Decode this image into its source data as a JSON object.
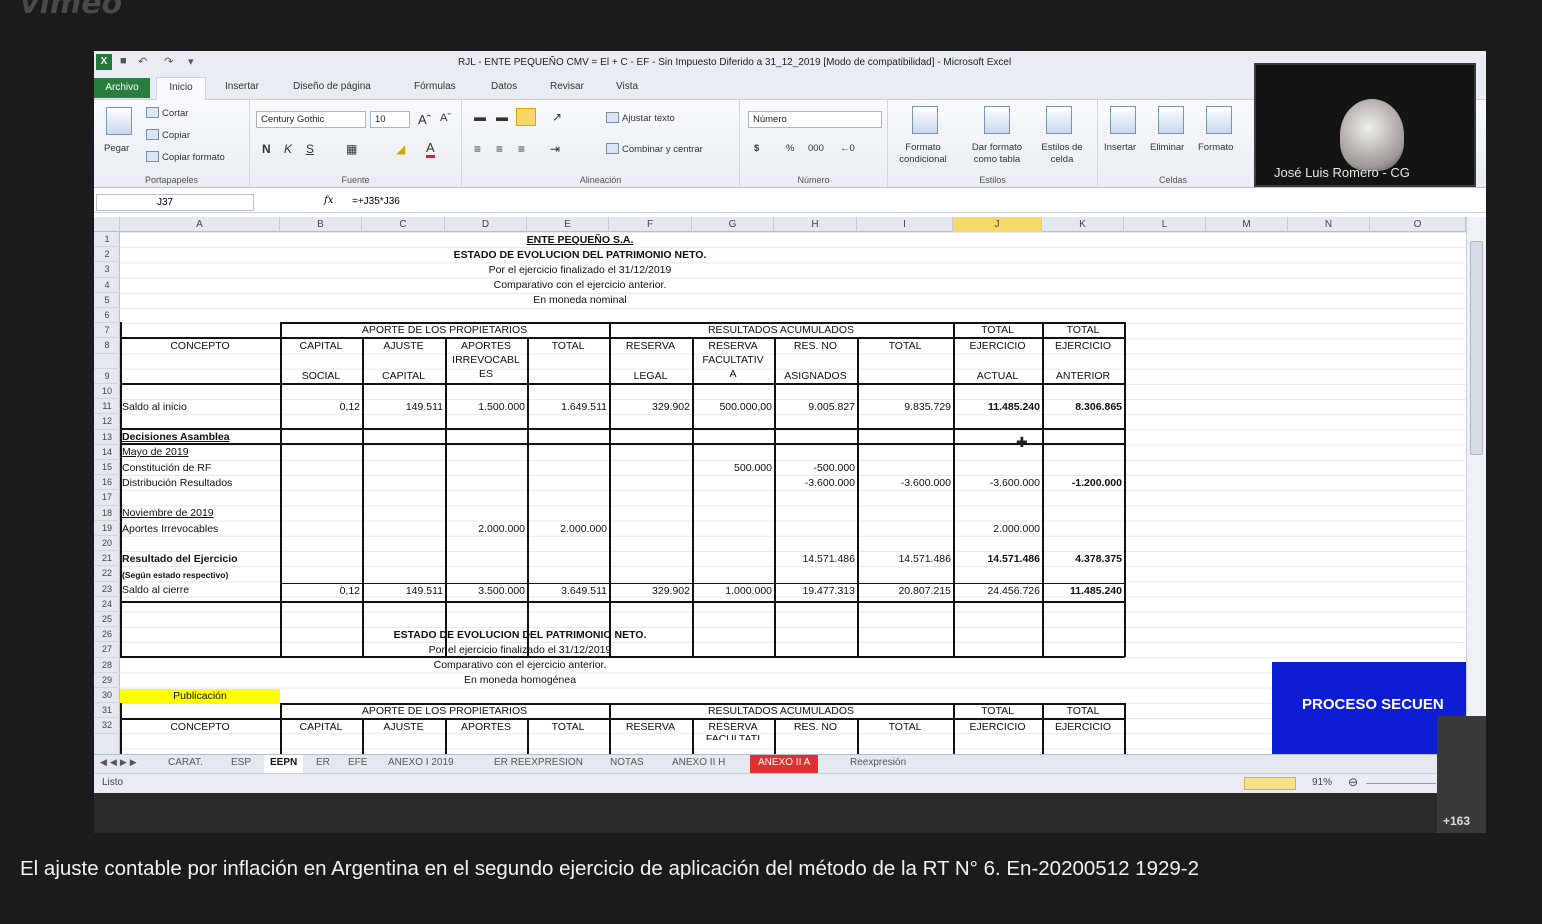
{
  "brand": "vimeo",
  "video_title": "El ajuste contable por inflación en Argentina en el segundo ejercicio de aplicación del método de la RT N° 6. En-20200512 1929-2",
  "excel": {
    "window_title": "RJL - ENTE PEQUEÑO CMV = El + C - EF - Sin Impuesto Diferido a 31_12_2019  [Modo de compatibilidad] - Microsoft Excel",
    "ribbon_tabs": [
      "Archivo",
      "Inicio",
      "Insertar",
      "Diseño de página",
      "Fórmulas",
      "Datos",
      "Revisar",
      "Vista"
    ],
    "clipboard": {
      "paste": "Pegar",
      "cut": "Cortar",
      "copy": "Copiar",
      "format_painter": "Copiar formato",
      "label": "Portapapeles"
    },
    "font": {
      "family": "Century Gothic",
      "size": "10",
      "label": "Fuente"
    },
    "alignment": {
      "wrap": "Ajustar texto",
      "merge": "Combinar y centrar",
      "label": "Alineación"
    },
    "number": {
      "format": "Número",
      "label": "Número"
    },
    "styles": {
      "conditional": "Formato condicional",
      "table": "Dar formato como tabla",
      "cell": "Estilos de celda",
      "label": "Estilos"
    },
    "cells": {
      "insert": "Insertar",
      "delete": "Eliminar",
      "format": "Formato",
      "label": "Celdas"
    },
    "name_box": "J37",
    "formula": "=+J35*J36",
    "columns": [
      "A",
      "B",
      "C",
      "D",
      "E",
      "F",
      "G",
      "H",
      "I",
      "J",
      "K",
      "L",
      "M",
      "N",
      "O"
    ],
    "rows": [
      "1",
      "2",
      "3",
      "4",
      "5",
      "6",
      "7",
      "8",
      "",
      "9",
      "10",
      "11",
      "12",
      "13",
      "14",
      "15",
      "16",
      "17",
      "18",
      "19",
      "20",
      "21",
      "22",
      "23",
      "24",
      "25",
      "26",
      "27",
      "28",
      "29",
      "30",
      "31",
      "32"
    ],
    "sheet": {
      "t1": "ENTE PEQUEÑO S.A.",
      "t2": "ESTADO DE EVOLUCION DEL PATRIMONIO NETO.",
      "t3": "Por el ejercicio finalizado el 31/12/2019",
      "t4": "Comparativo con el ejercicio anterior.",
      "t5": "En moneda nominal",
      "h_aporte": "APORTE DE LOS PROPIETARIOS",
      "h_result": "RESULTADOS ACUMULADOS",
      "h_total": "TOTAL",
      "concepto": "CONCEPTO",
      "capital": "CAPITAL",
      "social": "SOCIAL",
      "ajuste": "AJUSTE",
      "ajuste_cap": "CAPITAL",
      "aportes": "APORTES",
      "irrevocabl": "IRREVOCABL",
      "es": "ES",
      "total": "TOTAL",
      "reserva": "RESERVA",
      "legal": "LEGAL",
      "facultativ": "FACULTATIV",
      "a": "A",
      "resno": "RES. NO",
      "asignados": "ASIGNADOS",
      "ejercicio": "EJERCICIO",
      "actual": "ACTUAL",
      "anterior": "ANTERIOR",
      "saldo_inicio": "Saldo al inicio",
      "v11": [
        "0,12",
        "149.511",
        "1.500.000",
        "1.649.511",
        "329.902",
        "500.000,00",
        "9.005.827",
        "9.835.729",
        "11.485.240",
        "8.306.865"
      ],
      "decisiones": "Decisiones Asamblea",
      "mayo": "Mayo de 2019",
      "constitucion": "Constitución de RF",
      "v15g": "500.000",
      "v15h": "-500.000",
      "distribucion": "Distribución Resultados",
      "v16": [
        "-3.600.000",
        "-3.600.000",
        "-3.600.000",
        "-1.200.000"
      ],
      "noviembre": "Noviembre de 2019",
      "aportes_irrev": "Aportes Irrevocables",
      "v19": [
        "2.000.000",
        "2.000.000",
        "2.000.000"
      ],
      "resultado": "Resultado del Ejercicio",
      "v21": [
        "14.571.486",
        "14.571.486",
        "14.571.486",
        "4.378.375"
      ],
      "segun": "(Según estado respectivo)",
      "saldo_cierre": "Saldo al cierre",
      "v23": [
        "0,12",
        "149.511",
        "3.500.000",
        "3.649.511",
        "329.902",
        "1.000.000",
        "19.477.313",
        "20.807.215",
        "24.456.726",
        "11.485.240"
      ],
      "t26": "ESTADO DE EVOLUCION DEL PATRIMONIO NETO.",
      "t27": "Por el ejercicio finalizado el 31/12/2019",
      "t28": "Comparativo con el ejercicio anterior.",
      "t29": "En moneda homogénea",
      "publicacion": "Publicación",
      "r32_facul": "FACULTATI"
    },
    "sheet_tabs": [
      "CARAT.",
      "ESP",
      "EEPN",
      "ER",
      "EFE",
      "ANEXO I 2019",
      "ER REEXPRESION",
      "NOTAS",
      "ANEXO II H",
      "ANEXO II A",
      "Reexpresión"
    ],
    "active_sheet_tab_index": 2,
    "status": "Listo",
    "zoom": "91%"
  },
  "webcam_name": "José Luis Romero - CG",
  "overlay_banner": "PROCESO SECUEN",
  "participants": "+163",
  "colors": {
    "accent": "#2a7d3f",
    "banner": "#0d1ed4",
    "highlight": "#ffff00",
    "tab_red": "#e03030"
  }
}
